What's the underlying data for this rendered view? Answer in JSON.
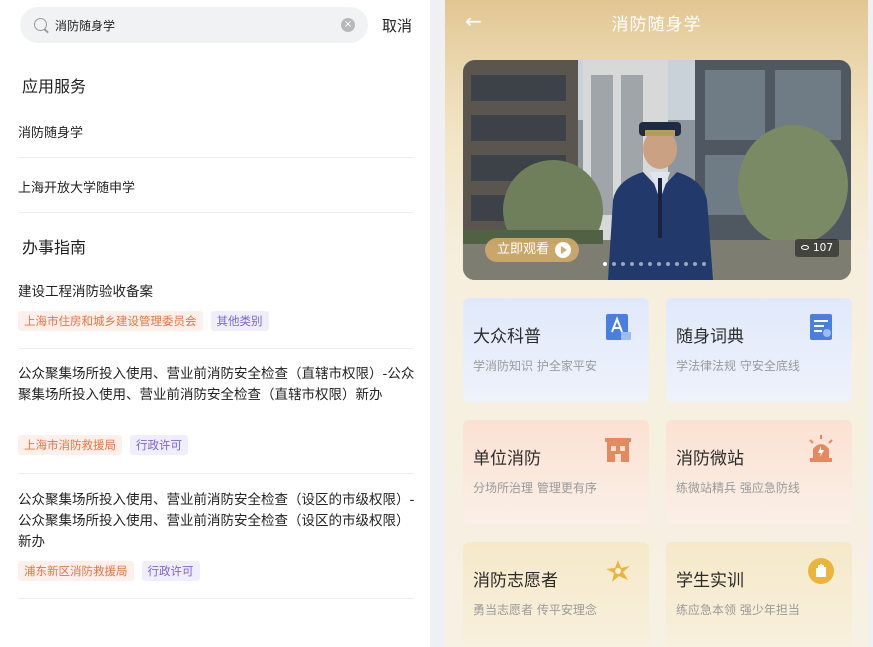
{
  "search": {
    "value": "消防随身学",
    "cancel_label": "取消",
    "clear_icon": "clear-icon"
  },
  "app_services": {
    "title": "应用服务",
    "items": [
      "消防随身学",
      "上海开放大学随申学"
    ]
  },
  "guide": {
    "title": "办事指南",
    "items": [
      {
        "title": "建设工程消防验收备案",
        "tags": [
          "上海市住房和城乡建设管理委员会",
          "其他类别"
        ]
      },
      {
        "title": "公众聚集场所投入使用、营业前消防安全检查（直辖市权限）-公众聚集场所投入使用、营业前消防安全检查（直辖市权限）新办",
        "tags": [
          "上海市消防救援局",
          "行政许可"
        ]
      },
      {
        "title": "公众聚集场所投入使用、营业前消防安全检查（设区的市级权限）-公众聚集场所投入使用、营业前消防安全检查（设区的市级权限）新办",
        "tags": [
          "浦东新区消防救援局",
          "行政许可"
        ]
      }
    ]
  },
  "app": {
    "title": "消防随身学",
    "back_icon": "back-arrow-icon",
    "hero": {
      "watch_label": "立即观看",
      "views": "107"
    },
    "cards": [
      {
        "title": "大众科普",
        "subtitle": "学消防知识  护全家平安",
        "icon": "document-a-icon",
        "tone": "blue",
        "accent": "#4a7fe0"
      },
      {
        "title": "随身词典",
        "subtitle": "学法律法规  守安全底线",
        "icon": "dictionary-icon",
        "tone": "blue",
        "accent": "#4a7fe0"
      },
      {
        "title": "单位消防",
        "subtitle": "分场所治理  管理更有序",
        "icon": "building-icon",
        "tone": "peach",
        "accent": "#e58a5e"
      },
      {
        "title": "消防微站",
        "subtitle": "练微站精兵  强应急防线",
        "icon": "alarm-light-icon",
        "tone": "peach",
        "accent": "#e58a5e"
      },
      {
        "title": "消防志愿者",
        "subtitle": "勇当志愿者  传平安理念",
        "icon": "volunteer-icon",
        "tone": "gold",
        "accent": "#eab53a"
      },
      {
        "title": "学生实训",
        "subtitle": "练应急本领  强少年担当",
        "icon": "hand-badge-icon",
        "tone": "gold",
        "accent": "#eab53a"
      }
    ]
  }
}
